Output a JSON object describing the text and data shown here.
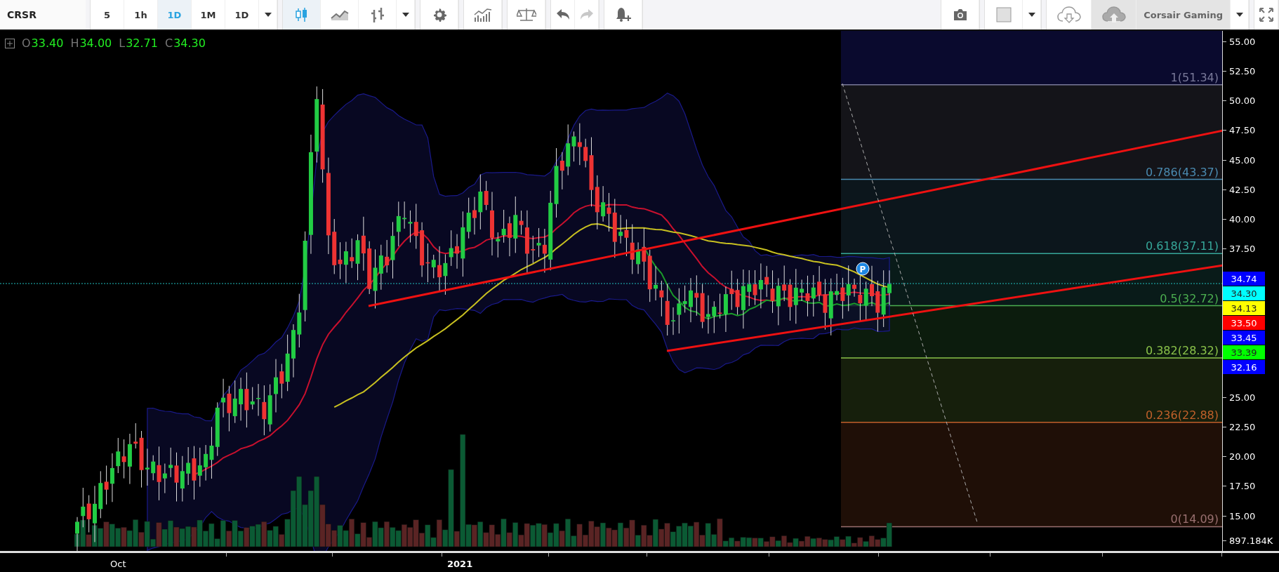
{
  "toolbar": {
    "symbol": "CRSR",
    "intervals": [
      {
        "label": "5",
        "selected": false
      },
      {
        "label": "1h",
        "selected": false
      },
      {
        "label": "1D",
        "selected": true
      },
      {
        "label": "1M",
        "selected": false
      },
      {
        "label": "1D",
        "selected": false
      }
    ],
    "chart_styles": [
      {
        "kind": "candles",
        "selected": true
      },
      {
        "kind": "line",
        "selected": false
      },
      {
        "kind": "bars",
        "selected": false
      }
    ],
    "history": [
      {
        "kind": "undo",
        "disabled": false
      },
      {
        "kind": "redo",
        "disabled": true
      }
    ],
    "cloud": [
      {
        "kind": "download",
        "selected": false
      },
      {
        "kind": "upload",
        "selected": true
      }
    ],
    "layout_name": "Corsair Gaming"
  },
  "legend": [
    {
      "label": "O",
      "value": "33.40"
    },
    {
      "label": "H",
      "value": "34.00"
    },
    {
      "label": "L",
      "value": "32.71"
    },
    {
      "label": "C",
      "value": "34.30"
    }
  ],
  "marker": {
    "label": "P"
  },
  "fibonacci": [
    {
      "label": "1(51.34)",
      "color": "#7a7a9a"
    },
    {
      "label": "0.786(43.37)",
      "color": "#4a8ab0"
    },
    {
      "label": "0.618(37.11)",
      "color": "#36a89a"
    },
    {
      "label": "0.5(32.72)",
      "color": "#4caf50"
    },
    {
      "label": "0.382(28.32)",
      "color": "#8bc34a"
    },
    {
      "label": "0.236(22.88)",
      "color": "#c0602a"
    },
    {
      "label": "0(14.09)",
      "color": "#9a7070"
    }
  ],
  "price_axis": {
    "ticks": [
      "55.00",
      "52.50",
      "50.00",
      "47.50",
      "45.00",
      "42.50",
      "40.00",
      "37.50",
      "25.00",
      "22.50",
      "20.00",
      "17.50",
      "15.00"
    ],
    "badges": [
      {
        "value": "34.74",
        "color": "#0000ff"
      },
      {
        "value": "34.30",
        "color": "#00ffff"
      },
      {
        "value": "34.13",
        "color": "#ffff00"
      },
      {
        "value": "33.50",
        "color": "#ff0000"
      },
      {
        "value": "33.45",
        "color": "#0000ff"
      },
      {
        "value": "33.39",
        "color": "#00ff00"
      },
      {
        "value": "32.16",
        "color": "#0000ff"
      }
    ],
    "volume_label": "897.184K"
  },
  "time_axis": [
    {
      "label": "Oct",
      "kind": "month"
    },
    {
      "label": "2021",
      "kind": "year"
    }
  ]
}
